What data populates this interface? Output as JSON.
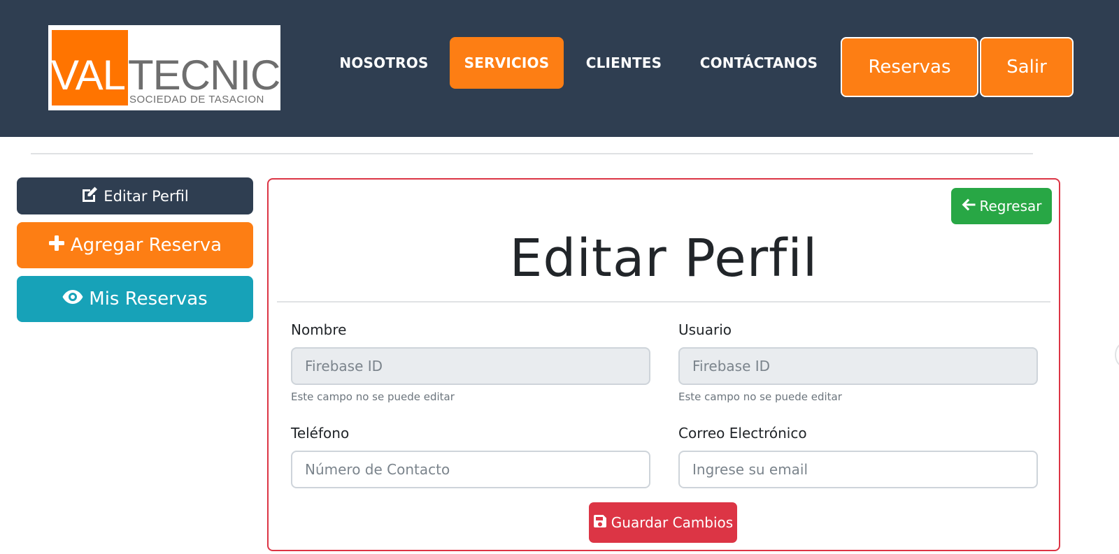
{
  "header": {
    "logo": {
      "val": "VAL",
      "tecnic": "TECNIC",
      "subtitle": "SOCIEDAD DE TASACION"
    },
    "nav": [
      {
        "label": "NOSOTROS"
      },
      {
        "label": "SERVICIOS",
        "active": true
      },
      {
        "label": "CLIENTES"
      },
      {
        "label": "CONTÁCTANOS"
      }
    ],
    "reservas_label": "Reservas",
    "salir_label": "Salir"
  },
  "sidebar": {
    "edit_profile": {
      "label": "Editar Perfil",
      "icon": "edit-icon"
    },
    "add_booking": {
      "label": "Agregar Reserva",
      "icon": "plus-icon"
    },
    "my_bookings": {
      "label": "Mis Reservas",
      "icon": "eye-icon"
    }
  },
  "main": {
    "back_label": "Regresar",
    "title": "Editar Perfil",
    "fields": {
      "nombre": {
        "label": "Nombre",
        "placeholder": "Firebase ID",
        "help": "Este campo no se puede editar"
      },
      "usuario": {
        "label": "Usuario",
        "placeholder": "Firebase ID",
        "help": "Este campo no se puede editar"
      },
      "telefono": {
        "label": "Teléfono",
        "placeholder": "Número de Contacto"
      },
      "correo": {
        "label": "Correo Electrónico",
        "placeholder": "Ingrese su email"
      }
    },
    "save_label": "Guardar Cambios"
  },
  "colors": {
    "navbar": "#2f3e51",
    "accent_orange": "#fd7e14",
    "info_teal": "#17a2b8",
    "success_green": "#28a745",
    "danger_red": "#dc3545"
  }
}
